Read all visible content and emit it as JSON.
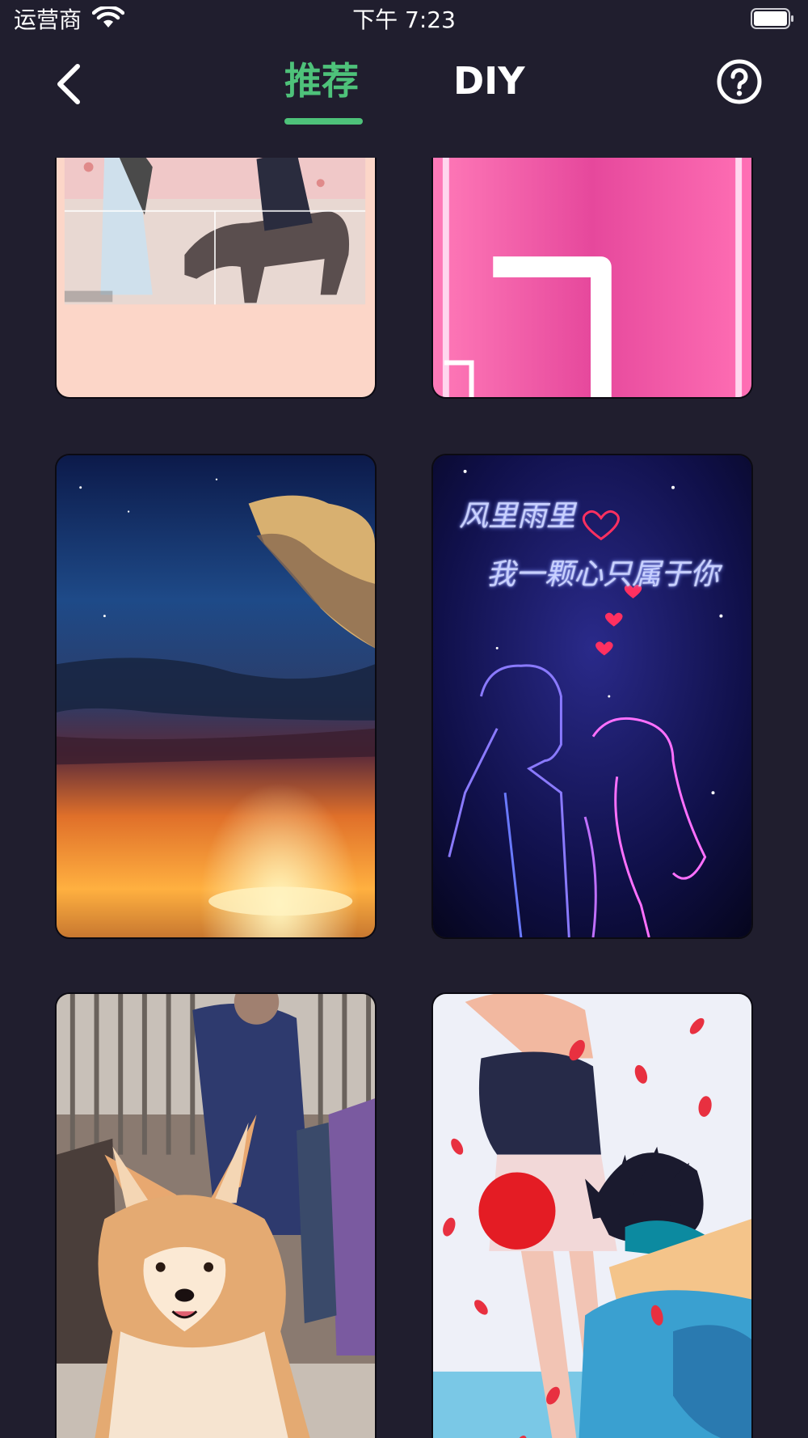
{
  "status_bar": {
    "carrier": "运营商",
    "time": "下午 7:23",
    "wifi_icon": "wifi-icon",
    "battery_icon": "battery-icon"
  },
  "nav": {
    "back_icon": "chevron-left-icon",
    "tabs": [
      {
        "label": "推荐",
        "active": true
      },
      {
        "label": "DIY",
        "active": false
      }
    ],
    "help_icon": "question-circle-icon",
    "accent_color": "#4ec27a"
  },
  "grid": {
    "cards": [
      {
        "name": "wallpaper-card-girl-horse"
      },
      {
        "name": "wallpaper-card-pink-neon"
      },
      {
        "name": "wallpaper-card-moon-sunset"
      },
      {
        "name": "wallpaper-card-neon-couple",
        "caption_line1": "风里雨里",
        "caption_line2": "我一颗心只属于你"
      },
      {
        "name": "wallpaper-card-corgi"
      },
      {
        "name": "wallpaper-card-anime-petals"
      }
    ]
  },
  "colors": {
    "background": "#201e2e",
    "active_tab": "#4ec27a",
    "inactive_tab": "#ffffff"
  }
}
